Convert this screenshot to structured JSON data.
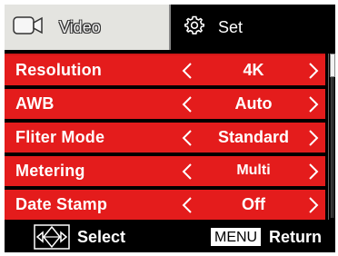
{
  "tabs": {
    "video": {
      "label": "Video",
      "icon": "video-camera-icon",
      "selected": true
    },
    "set": {
      "label": "Set",
      "icon": "gear-icon",
      "selected": false
    }
  },
  "menu": {
    "items": [
      {
        "label": "Resolution",
        "value": "4K"
      },
      {
        "label": "AWB",
        "value": "Auto"
      },
      {
        "label": "Fliter Mode",
        "value": "Standard"
      },
      {
        "label": "Metering",
        "value": "Multi"
      },
      {
        "label": "Date Stamp",
        "value": "Off"
      }
    ]
  },
  "footer": {
    "select_label": "Select",
    "menu_key": "MENU",
    "return_label": "Return"
  },
  "colors": {
    "highlight_red": "#e41c1c",
    "background": "#000000",
    "tab_active": "#e4e4e0"
  }
}
